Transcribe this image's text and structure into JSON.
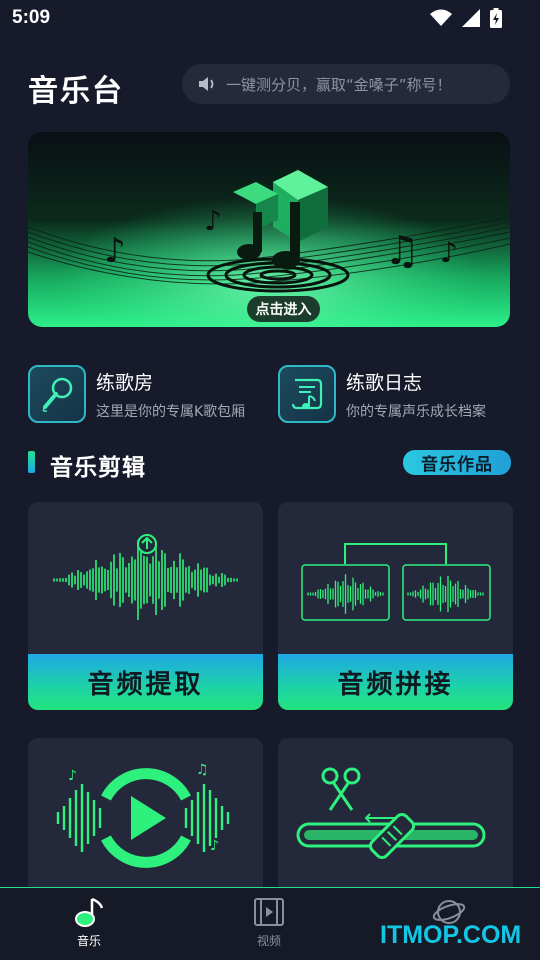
{
  "status_bar": {
    "time": "5:09"
  },
  "header": {
    "title": "音乐台",
    "promo_text": "一键测分贝，赢取“金嗓子”称号！"
  },
  "banner": {
    "enter_label": "点击进入"
  },
  "features": [
    {
      "title": "练歌房",
      "desc": "这里是你的专属K歌包厢",
      "icon": "microphone-icon"
    },
    {
      "title": "练歌日志",
      "desc": "你的专属声乐成长档案",
      "icon": "music-scroll-icon"
    }
  ],
  "section": {
    "title": "音乐剪辑",
    "badge": "音乐作品"
  },
  "cards": [
    {
      "label": "音频提取",
      "icon": "audio-extract-icon"
    },
    {
      "label": "音频拼接",
      "icon": "audio-join-icon"
    },
    {
      "label": "",
      "icon": "audio-convert-icon"
    },
    {
      "label": "",
      "icon": "audio-cut-icon"
    }
  ],
  "bottom_nav": [
    {
      "label": "音乐",
      "icon": "music-note-icon",
      "active": true
    },
    {
      "label": "视频",
      "icon": "film-icon",
      "active": false
    },
    {
      "label": "",
      "icon": "planet-icon",
      "active": false
    }
  ],
  "watermark": "ITMOP.COM",
  "colors": {
    "accent_green": "#22e08d",
    "accent_cyan": "#1fa8e6",
    "background": "#161a2a",
    "card": "#23283a"
  }
}
